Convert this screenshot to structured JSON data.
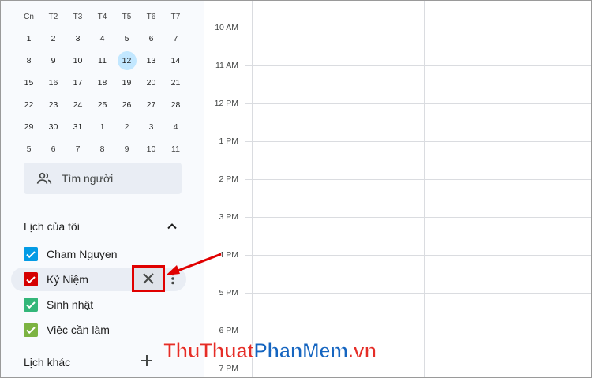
{
  "mini_calendar": {
    "weekdays": [
      "Cn",
      "T2",
      "T3",
      "T4",
      "T5",
      "T6",
      "T7"
    ],
    "weeks": [
      [
        "1",
        "2",
        "3",
        "4",
        "5",
        "6",
        "7"
      ],
      [
        "8",
        "9",
        "10",
        "11",
        "12",
        "13",
        "14"
      ],
      [
        "15",
        "16",
        "17",
        "18",
        "19",
        "20",
        "21"
      ],
      [
        "22",
        "23",
        "24",
        "25",
        "26",
        "27",
        "28"
      ],
      [
        "29",
        "30",
        "31",
        "1",
        "2",
        "3",
        "4"
      ],
      [
        "5",
        "6",
        "7",
        "8",
        "9",
        "10",
        "11"
      ]
    ],
    "today": "12"
  },
  "search_people": {
    "label": "Tìm người"
  },
  "my_calendars": {
    "title": "Lịch của tôi",
    "items": [
      {
        "name": "Cham Nguyen",
        "color": "#039be5"
      },
      {
        "name": "Kỷ Niệm",
        "color": "#d50000"
      },
      {
        "name": "Sinh nhật",
        "color": "#33b679"
      },
      {
        "name": "Việc cần làm",
        "color": "#7cb342"
      }
    ]
  },
  "other_calendars": {
    "title": "Lịch khác"
  },
  "times": [
    "10 AM",
    "11 AM",
    "12 PM",
    "1 PM",
    "2 PM",
    "3 PM",
    "4 PM",
    "5 PM",
    "6 PM",
    "7 PM"
  ],
  "watermark": {
    "part1": "ThuThuat",
    "part2": "PhanMem",
    "part3": ".vn"
  }
}
